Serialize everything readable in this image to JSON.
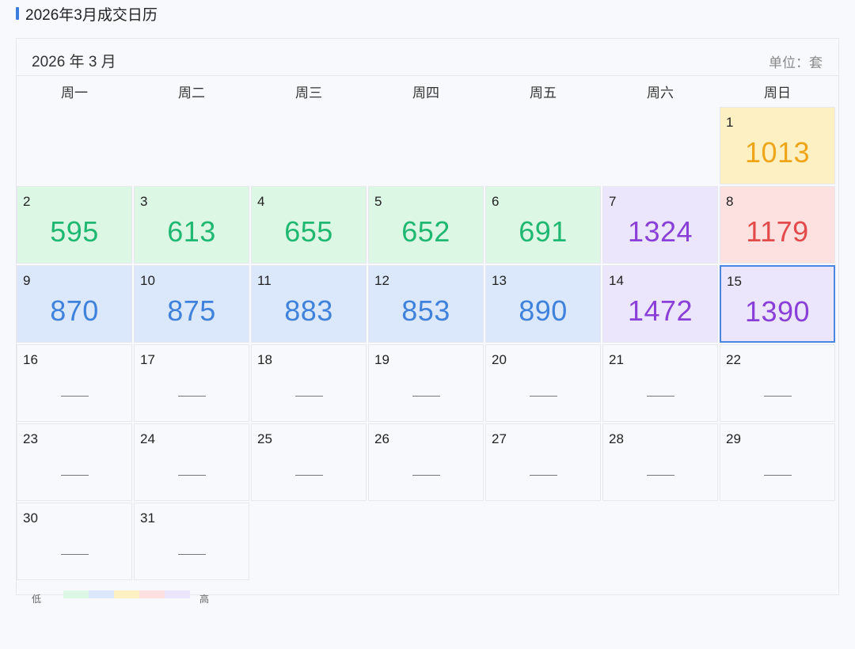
{
  "title": "2026年3月成交日历",
  "month_label": "2026 年 3 月",
  "unit_label": "单位：套",
  "weekdays": [
    "周一",
    "周二",
    "周三",
    "周四",
    "周五",
    "周六",
    "周日"
  ],
  "empty_placeholder": "—",
  "selected_day": 15,
  "tiers": {
    "green": {
      "bg": "#dcf7e4",
      "fg": "#1fb873"
    },
    "blue": {
      "bg": "#dbe8fb",
      "fg": "#3f82dc"
    },
    "yellow": {
      "bg": "#fdf1c4",
      "fg": "#eea51a"
    },
    "red": {
      "bg": "#fde0e0",
      "fg": "#e34a4a"
    },
    "purple": {
      "bg": "#ebe6fb",
      "fg": "#8a3fd8"
    }
  },
  "days": [
    {
      "day": "1",
      "value": "1013",
      "tier": "yellow"
    },
    {
      "day": "2",
      "value": "595",
      "tier": "green"
    },
    {
      "day": "3",
      "value": "613",
      "tier": "green"
    },
    {
      "day": "4",
      "value": "655",
      "tier": "green"
    },
    {
      "day": "5",
      "value": "652",
      "tier": "green"
    },
    {
      "day": "6",
      "value": "691",
      "tier": "green"
    },
    {
      "day": "7",
      "value": "1324",
      "tier": "purple"
    },
    {
      "day": "8",
      "value": "1179",
      "tier": "red"
    },
    {
      "day": "9",
      "value": "870",
      "tier": "blue"
    },
    {
      "day": "10",
      "value": "875",
      "tier": "blue"
    },
    {
      "day": "11",
      "value": "883",
      "tier": "blue"
    },
    {
      "day": "12",
      "value": "853",
      "tier": "blue"
    },
    {
      "day": "13",
      "value": "890",
      "tier": "blue"
    },
    {
      "day": "14",
      "value": "1472",
      "tier": "purple"
    },
    {
      "day": "15",
      "value": "1390",
      "tier": "purple"
    },
    {
      "day": "16",
      "value": null,
      "tier": null
    },
    {
      "day": "17",
      "value": null,
      "tier": null
    },
    {
      "day": "18",
      "value": null,
      "tier": null
    },
    {
      "day": "19",
      "value": null,
      "tier": null
    },
    {
      "day": "20",
      "value": null,
      "tier": null
    },
    {
      "day": "21",
      "value": null,
      "tier": null
    },
    {
      "day": "22",
      "value": null,
      "tier": null
    },
    {
      "day": "23",
      "value": null,
      "tier": null
    },
    {
      "day": "24",
      "value": null,
      "tier": null
    },
    {
      "day": "25",
      "value": null,
      "tier": null
    },
    {
      "day": "26",
      "value": null,
      "tier": null
    },
    {
      "day": "27",
      "value": null,
      "tier": null
    },
    {
      "day": "28",
      "value": null,
      "tier": null
    },
    {
      "day": "29",
      "value": null,
      "tier": null
    },
    {
      "day": "30",
      "value": null,
      "tier": null
    },
    {
      "day": "31",
      "value": null,
      "tier": null
    }
  ],
  "legend": {
    "low_label": "低",
    "high_label": "高",
    "swatches": [
      "#dcf7e4",
      "#dbe8fb",
      "#fdf1c4",
      "#fde0e0",
      "#ebe6fb"
    ]
  }
}
